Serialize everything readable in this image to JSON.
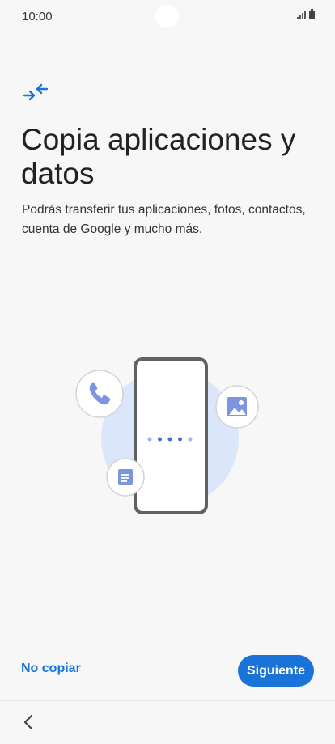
{
  "status_bar": {
    "time": "10:00"
  },
  "header": {
    "icon": "transfer-arrows-icon",
    "title": "Copia aplicaciones y datos",
    "subtitle": "Podrás transferir tus aplicaciones, fotos, contactos, cuenta de Google y mucho más."
  },
  "illustration": {
    "icons": [
      "phone-icon",
      "image-icon",
      "document-icon"
    ]
  },
  "footer": {
    "skip_label": "No copiar",
    "next_label": "Siguiente"
  },
  "nav": {
    "back_icon": "back-chevron-icon"
  },
  "colors": {
    "accent": "#1a73d9",
    "background": "#f7f7f7",
    "illustration_blue": "#dce6fb"
  }
}
